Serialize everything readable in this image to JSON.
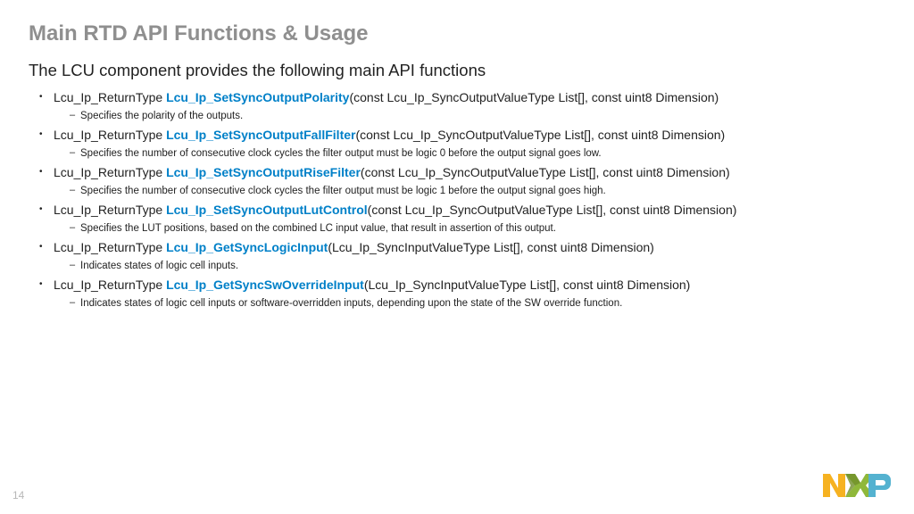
{
  "title": "Main RTD API Functions & Usage",
  "subtitle": "The LCU component provides the following main API functions",
  "items": [
    {
      "ret": "Lcu_Ip_ReturnType ",
      "fn": "Lcu_Ip_SetSyncOutputPolarity",
      "sig": "(const Lcu_Ip_SyncOutputValueType List[], const uint8 Dimension)",
      "desc": "Specifies the polarity of the outputs."
    },
    {
      "ret": "Lcu_Ip_ReturnType ",
      "fn": "Lcu_Ip_SetSyncOutputFallFilter",
      "sig": "(const Lcu_Ip_SyncOutputValueType List[], const uint8 Dimension)",
      "desc": "Specifies the number of consecutive clock cycles the filter output must be logic 0 before the output signal goes low."
    },
    {
      "ret": "Lcu_Ip_ReturnType ",
      "fn": "Lcu_Ip_SetSyncOutputRiseFilter",
      "sig": "(const Lcu_Ip_SyncOutputValueType List[], const uint8 Dimension)",
      "desc": "Specifies the number of consecutive clock cycles the filter output must be logic 1 before the output signal goes high."
    },
    {
      "ret": "Lcu_Ip_ReturnType ",
      "fn": "Lcu_Ip_SetSyncOutputLutControl",
      "sig": "(const Lcu_Ip_SyncOutputValueType List[], const uint8 Dimension)",
      "desc": "Specifies the LUT positions, based on the combined LC input value, that result in assertion of this output."
    },
    {
      "ret": "Lcu_Ip_ReturnType ",
      "fn": "Lcu_Ip_GetSyncLogicInput",
      "sig": "(Lcu_Ip_SyncInputValueType List[], const uint8 Dimension)",
      "desc": "Indicates states of logic cell inputs."
    },
    {
      "ret": "Lcu_Ip_ReturnType ",
      "fn": "Lcu_Ip_GetSyncSwOverrideInput",
      "sig": "(Lcu_Ip_SyncInputValueType List[], const uint8 Dimension)",
      "desc": "Indicates states of logic cell inputs or software-overridden inputs, depending upon the state of the SW override function."
    }
  ],
  "page": "14"
}
